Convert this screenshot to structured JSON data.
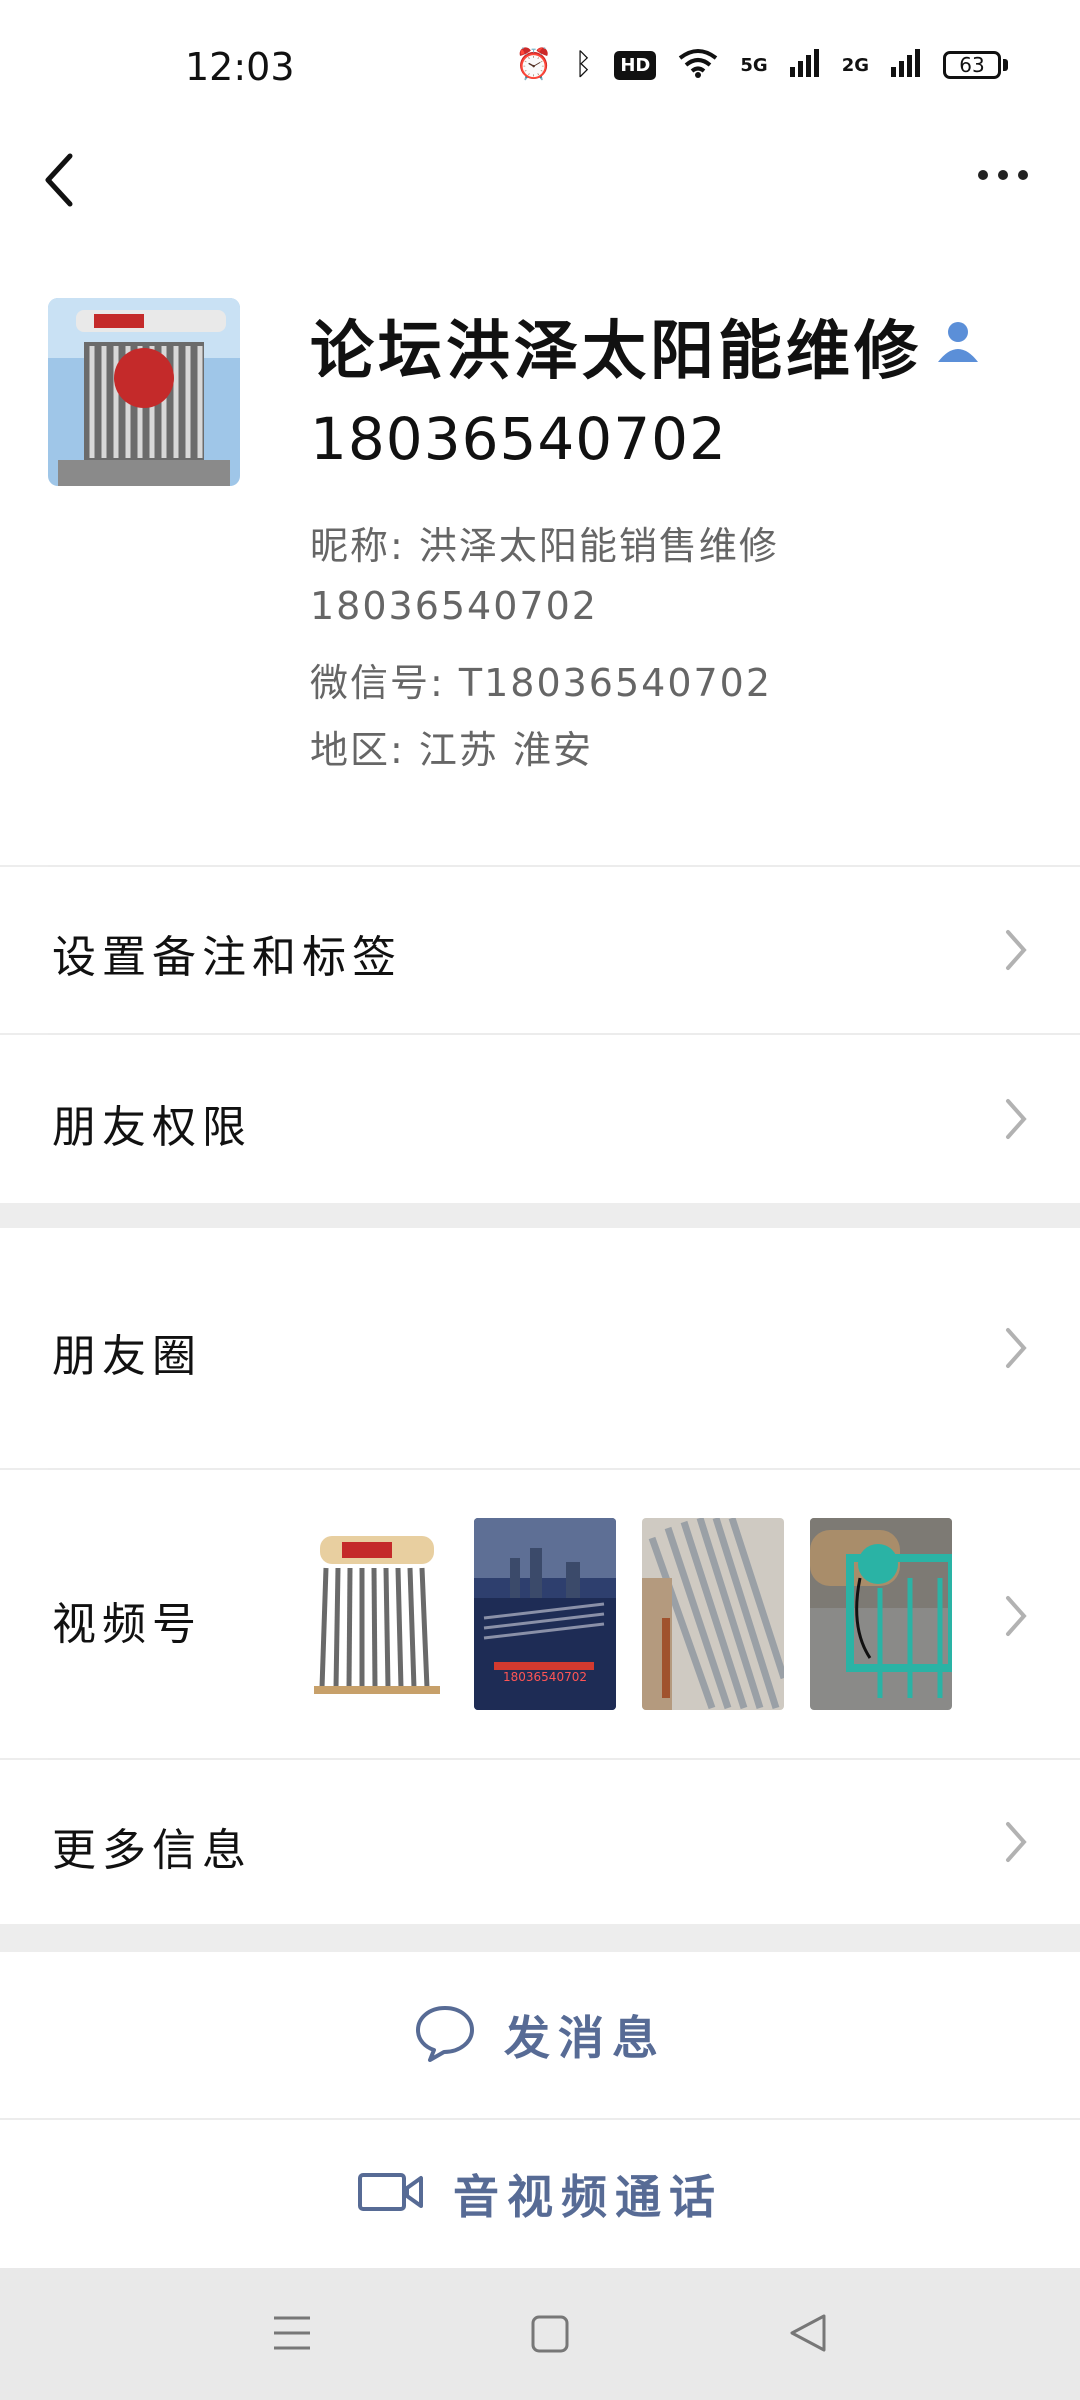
{
  "status": {
    "time": "12:03",
    "network_5g": "5G",
    "network_2g": "2G",
    "battery": "63"
  },
  "profile": {
    "name": "论坛洪泽太阳能维修",
    "phone": "18036540702",
    "nickname": "昵称: 洪泽太阳能销售维修",
    "nickname_cont": "18036540702",
    "wechat_id": "微信号: T18036540702",
    "region": "地区: 江苏  淮安"
  },
  "rows": {
    "remark": "设置备注和标签",
    "permissions": "朋友权限",
    "moments": "朋友圈",
    "channels": "视频号",
    "more_info": "更多信息"
  },
  "thumbs": {
    "second_caption": "18036540702"
  },
  "actions": {
    "message": "发消息",
    "call": "音视频通话"
  },
  "icons": [
    "back-arrow-icon",
    "more-dots-icon",
    "contact-person-icon",
    "chevron-right-icon",
    "chat-bubble-icon",
    "video-camera-icon",
    "menu-icon",
    "home-square-icon",
    "back-triangle-icon"
  ],
  "colors": {
    "action_text": "#576b95",
    "badge_blue": "#5b8fd8",
    "page_bg": "#ededed"
  }
}
